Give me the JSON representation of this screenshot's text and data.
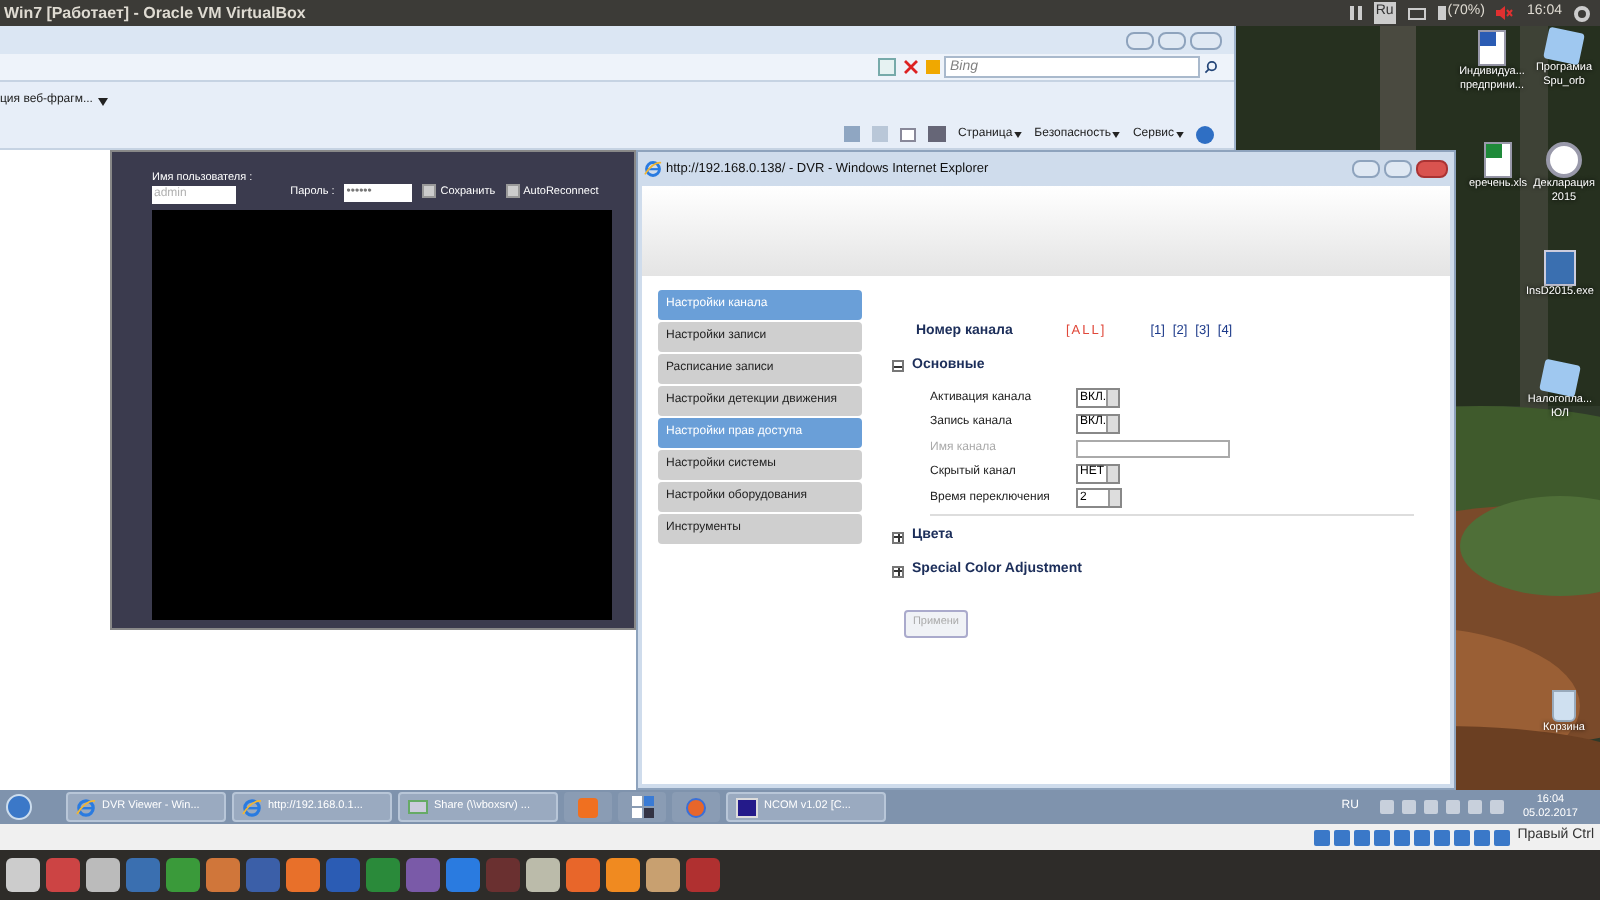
{
  "host_bar": {
    "title": "Win7 [Работает] - Oracle VM VirtualBox",
    "keyboard": "Ru",
    "battery": "(70%)",
    "time": "16:04"
  },
  "browser_back": {
    "search_placeholder": "Bing",
    "favorites_item": "ция веб-фрагм...",
    "command_menus": [
      "Страница",
      "Безопасность",
      "Сервис"
    ]
  },
  "dvr_viewer": {
    "username_label": "Имя пользователя :",
    "username_placeholder": "admin",
    "password_label": "Пароль :",
    "password_value": "••••••",
    "checkboxes": [
      {
        "label": "Сохранить",
        "checked": false
      },
      {
        "label": "AutoReconnect",
        "checked": false
      }
    ]
  },
  "dvr_window": {
    "title": "http://192.168.0.138/ - DVR - Windows Internet Explorer",
    "menu": [
      {
        "label": "Настройки канала",
        "selected": true
      },
      {
        "label": "Настройки записи",
        "selected": false
      },
      {
        "label": "Расписание записи",
        "selected": false
      },
      {
        "label": "Настройки детекции движения",
        "selected": false
      },
      {
        "label": "Настройки прав доступа",
        "selected": true
      },
      {
        "label": "Настройки системы",
        "selected": false
      },
      {
        "label": "Настройки оборудования",
        "selected": false
      },
      {
        "label": "Инструменты",
        "selected": false
      }
    ],
    "channel_label": "Номер канала",
    "channels": [
      {
        "label": "[ALL]",
        "selected": true
      },
      {
        "label": "[1]",
        "selected": false
      },
      {
        "label": "[2]",
        "selected": false
      },
      {
        "label": "[3]",
        "selected": false
      },
      {
        "label": "[4]",
        "selected": false
      }
    ],
    "sections": [
      {
        "title": "Основные",
        "expanded": true,
        "fields": [
          {
            "label": "Активация канала",
            "kind": "select",
            "value": "ВКЛ.",
            "disabled": false
          },
          {
            "label": "Запись канала",
            "kind": "select",
            "value": "ВКЛ.",
            "disabled": false
          },
          {
            "label": "Имя канала",
            "kind": "text",
            "disabled": true
          },
          {
            "label": "Скрытый канал",
            "kind": "select",
            "value": "НЕТ",
            "disabled": false
          },
          {
            "label": "Время переключения",
            "kind": "select",
            "value": "2",
            "disabled": false
          }
        ]
      },
      {
        "title": "Цвета",
        "expanded": false
      },
      {
        "title": "Special Color Adjustment",
        "expanded": false
      }
    ],
    "apply_button": "Примени"
  },
  "desktop_icons": [
    {
      "label": "Индивидуа... предприни...",
      "kind": "word"
    },
    {
      "label": "Програмиа Spu_orb",
      "kind": "shortcut"
    },
    {
      "label": "еречень.xls",
      "kind": "excel"
    },
    {
      "label": "Декларация 2015",
      "kind": "decl"
    },
    {
      "label": "InsD2015.exe",
      "kind": "setup"
    },
    {
      "label": "Налогопла... ЮЛ",
      "kind": "shortcut"
    },
    {
      "label": "Корзина",
      "kind": "bin"
    }
  ],
  "taskbar": {
    "items": [
      {
        "label": "DVR Viewer - Win...",
        "kind": "ie"
      },
      {
        "label": "http://192.168.0.1...",
        "kind": "ie"
      },
      {
        "label": "Share (\\\\vboxsrv) ...",
        "kind": "share"
      },
      {
        "kind": "media"
      },
      {
        "kind": "tiles"
      },
      {
        "kind": "firefox"
      },
      {
        "label": "NCOM v1.02  [C...",
        "kind": "ncom"
      }
    ],
    "language": "RU",
    "time": "16:04",
    "date": "05.02.2017"
  },
  "vbox_status": {
    "host_key": "Правый Ctrl"
  }
}
